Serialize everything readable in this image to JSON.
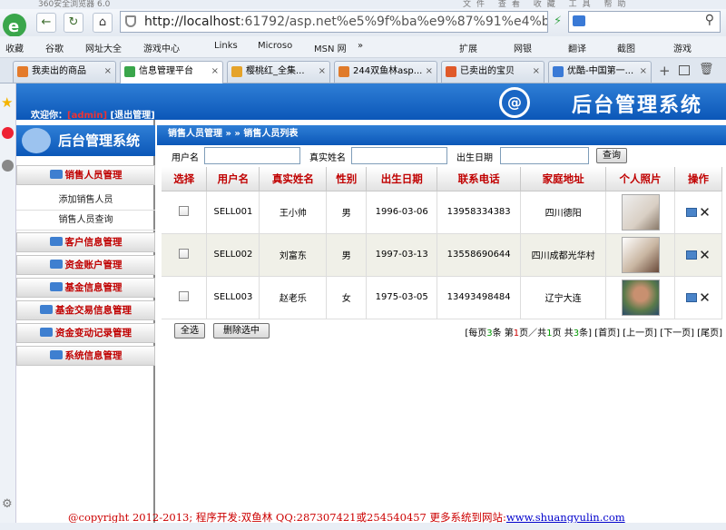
{
  "browser": {
    "window_title": "360安全浏览器 6.0",
    "menu": "文件 查看 收藏 工具 帮助",
    "address_host": "http://localhost",
    "address_rest": ":61792/asp.net%e5%9f%ba%e9%87%91%e4%ba%a4%",
    "bookmarks": [
      "收藏",
      "谷歌",
      "网址大全",
      "游戏中心",
      "Links",
      "Microso",
      "MSN 网",
      "»",
      "扩展",
      "网银",
      "翻译",
      "截图",
      "游戏"
    ],
    "tabs": [
      {
        "label": "我卖出的商品",
        "color": "#e47b2b"
      },
      {
        "label": "信息管理平台",
        "color": "#3aa64b"
      },
      {
        "label": "樱桃红_全集...",
        "color": "#e5a32a"
      },
      {
        "label": "244双鱼林asp...",
        "color": "#e07b2a"
      },
      {
        "label": "已卖出的宝贝",
        "color": "#e05a2a"
      },
      {
        "label": "优酷-中国第一...",
        "color": "#3a7ad6"
      }
    ]
  },
  "header": {
    "welcome_label": "欢迎你：",
    "username": "[admin]",
    "logout_label": "[退出管理]",
    "brand": "后台管理系统",
    "brand_logo": "@"
  },
  "sidebar": {
    "title": "后台管理系统",
    "sections": [
      {
        "label": "销售人员管理",
        "subitems": [
          "添加销售人员",
          "销售人员查询"
        ]
      },
      {
        "label": "客户信息管理"
      },
      {
        "label": "资金账户管理"
      },
      {
        "label": "基金信息管理"
      },
      {
        "label": "基金交易信息管理"
      },
      {
        "label": "资金变动记录管理"
      },
      {
        "label": "系统信息管理"
      }
    ]
  },
  "main": {
    "breadcrumb": "销售人员管理 » » 销售人员列表",
    "search": {
      "username_label": "用户名",
      "realname_label": "真实姓名",
      "birth_label": "出生日期",
      "query_button": "查询"
    },
    "table": {
      "columns": [
        "选择",
        "用户名",
        "真实姓名",
        "性别",
        "出生日期",
        "联系电话",
        "家庭地址",
        "个人照片",
        "操作"
      ],
      "rows": [
        {
          "username": "SELL001",
          "realname": "王小帅",
          "gender": "男",
          "birth": "1996-03-06",
          "phone": "13958334383",
          "address": "四川德阳",
          "photo_color": "#d9cfc4"
        },
        {
          "username": "SELL002",
          "realname": "刘富东",
          "gender": "男",
          "birth": "1997-03-13",
          "phone": "13558690644",
          "address": "四川成都光华村",
          "photo_color": "#c9b6a2"
        },
        {
          "username": "SELL003",
          "realname": "赵老乐",
          "gender": "女",
          "birth": "1975-03-05",
          "phone": "13493498484",
          "address": "辽宁大连",
          "photo_color": "#5a7a4a"
        }
      ]
    },
    "select_all_button": "全选",
    "delete_selected_button": "删除选中",
    "pager": {
      "p1": "[每页",
      "per_page": "3",
      "p2": "条 第",
      "current": "1",
      "p3": "页／共",
      "total_pages": "1",
      "p4": "页 共",
      "total": "3",
      "p5": "条]",
      "first": "[首页]",
      "prev": "[上一页]",
      "next": "[下一页]",
      "last": "[尾页]"
    }
  },
  "footer": {
    "text": "@copyright 2012-2013; 程序开发:双鱼林  QQ:287307421或254540457  更多系统到网站:",
    "link": "www.shuangyulin.com"
  }
}
